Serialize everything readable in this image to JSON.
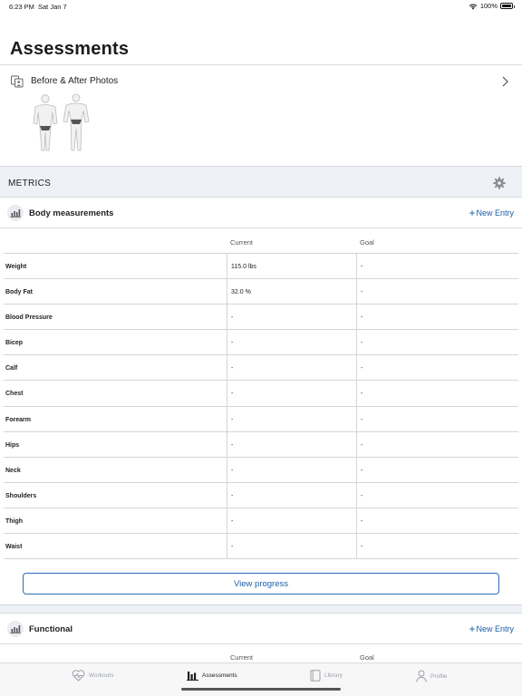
{
  "status_bar": {
    "time": "6:23 PM",
    "date": "Sat Jan 7",
    "battery": "100%",
    "battery_level": 1.0
  },
  "page": {
    "title": "Assessments"
  },
  "photos": {
    "label": "Before & After Photos"
  },
  "metrics": {
    "label": "METRICS"
  },
  "body_measurements": {
    "title": "Body measurements",
    "new_entry": "New Entry",
    "columns": {
      "current": "Current",
      "goal": "Goal"
    },
    "rows": [
      {
        "name": "Weight",
        "current": "115.0 lbs",
        "goal": "-"
      },
      {
        "name": "Body Fat",
        "current": "32.0 %",
        "goal": "-"
      },
      {
        "name": "Blood Pressure",
        "current": "-",
        "goal": "-"
      },
      {
        "name": "Bicep",
        "current": "-",
        "goal": "-"
      },
      {
        "name": "Calf",
        "current": "-",
        "goal": "-"
      },
      {
        "name": "Chest",
        "current": "-",
        "goal": "-"
      },
      {
        "name": "Forearm",
        "current": "-",
        "goal": "-"
      },
      {
        "name": "Hips",
        "current": "-",
        "goal": "-"
      },
      {
        "name": "Neck",
        "current": "-",
        "goal": "-"
      },
      {
        "name": "Shoulders",
        "current": "-",
        "goal": "-"
      },
      {
        "name": "Thigh",
        "current": "-",
        "goal": "-"
      },
      {
        "name": "Waist",
        "current": "-",
        "goal": "-"
      }
    ],
    "view_progress": "View progress"
  },
  "functional": {
    "title": "Functional",
    "new_entry": "New Entry",
    "columns": {
      "current": "Current",
      "goal": "Goal"
    }
  },
  "tabs": [
    {
      "label": "Workouts",
      "icon": "heart-pulse-icon"
    },
    {
      "label": "Assessments",
      "icon": "bar-chart-icon",
      "active": true
    },
    {
      "label": "Library",
      "icon": "book-icon"
    },
    {
      "label": "Profile",
      "icon": "person-icon"
    }
  ],
  "colors": {
    "accent": "#1e5ea8",
    "band": "#eef1f6",
    "divider": "#d2d5da"
  }
}
